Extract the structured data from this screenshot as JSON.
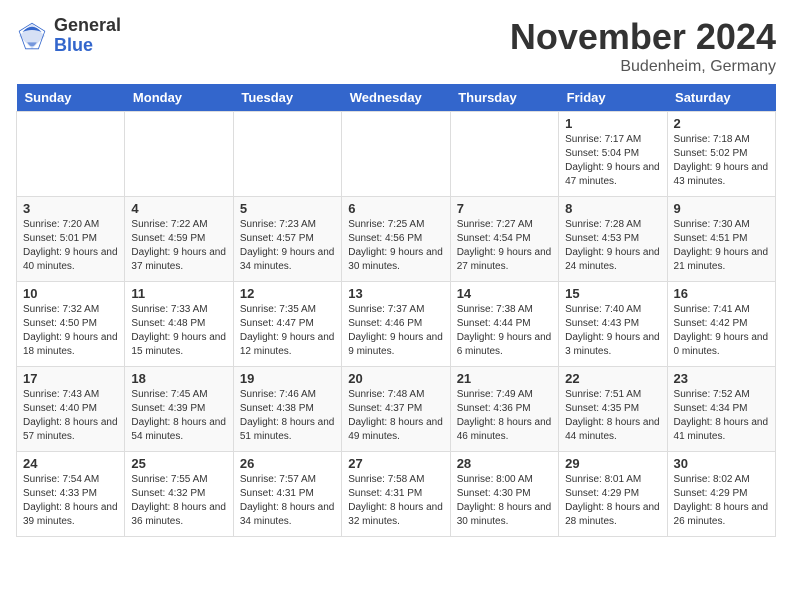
{
  "logo": {
    "general": "General",
    "blue": "Blue"
  },
  "title": "November 2024",
  "location": "Budenheim, Germany",
  "days_header": [
    "Sunday",
    "Monday",
    "Tuesday",
    "Wednesday",
    "Thursday",
    "Friday",
    "Saturday"
  ],
  "weeks": [
    [
      {
        "day": "",
        "info": ""
      },
      {
        "day": "",
        "info": ""
      },
      {
        "day": "",
        "info": ""
      },
      {
        "day": "",
        "info": ""
      },
      {
        "day": "",
        "info": ""
      },
      {
        "day": "1",
        "info": "Sunrise: 7:17 AM\nSunset: 5:04 PM\nDaylight: 9 hours and 47 minutes."
      },
      {
        "day": "2",
        "info": "Sunrise: 7:18 AM\nSunset: 5:02 PM\nDaylight: 9 hours and 43 minutes."
      }
    ],
    [
      {
        "day": "3",
        "info": "Sunrise: 7:20 AM\nSunset: 5:01 PM\nDaylight: 9 hours and 40 minutes."
      },
      {
        "day": "4",
        "info": "Sunrise: 7:22 AM\nSunset: 4:59 PM\nDaylight: 9 hours and 37 minutes."
      },
      {
        "day": "5",
        "info": "Sunrise: 7:23 AM\nSunset: 4:57 PM\nDaylight: 9 hours and 34 minutes."
      },
      {
        "day": "6",
        "info": "Sunrise: 7:25 AM\nSunset: 4:56 PM\nDaylight: 9 hours and 30 minutes."
      },
      {
        "day": "7",
        "info": "Sunrise: 7:27 AM\nSunset: 4:54 PM\nDaylight: 9 hours and 27 minutes."
      },
      {
        "day": "8",
        "info": "Sunrise: 7:28 AM\nSunset: 4:53 PM\nDaylight: 9 hours and 24 minutes."
      },
      {
        "day": "9",
        "info": "Sunrise: 7:30 AM\nSunset: 4:51 PM\nDaylight: 9 hours and 21 minutes."
      }
    ],
    [
      {
        "day": "10",
        "info": "Sunrise: 7:32 AM\nSunset: 4:50 PM\nDaylight: 9 hours and 18 minutes."
      },
      {
        "day": "11",
        "info": "Sunrise: 7:33 AM\nSunset: 4:48 PM\nDaylight: 9 hours and 15 minutes."
      },
      {
        "day": "12",
        "info": "Sunrise: 7:35 AM\nSunset: 4:47 PM\nDaylight: 9 hours and 12 minutes."
      },
      {
        "day": "13",
        "info": "Sunrise: 7:37 AM\nSunset: 4:46 PM\nDaylight: 9 hours and 9 minutes."
      },
      {
        "day": "14",
        "info": "Sunrise: 7:38 AM\nSunset: 4:44 PM\nDaylight: 9 hours and 6 minutes."
      },
      {
        "day": "15",
        "info": "Sunrise: 7:40 AM\nSunset: 4:43 PM\nDaylight: 9 hours and 3 minutes."
      },
      {
        "day": "16",
        "info": "Sunrise: 7:41 AM\nSunset: 4:42 PM\nDaylight: 9 hours and 0 minutes."
      }
    ],
    [
      {
        "day": "17",
        "info": "Sunrise: 7:43 AM\nSunset: 4:40 PM\nDaylight: 8 hours and 57 minutes."
      },
      {
        "day": "18",
        "info": "Sunrise: 7:45 AM\nSunset: 4:39 PM\nDaylight: 8 hours and 54 minutes."
      },
      {
        "day": "19",
        "info": "Sunrise: 7:46 AM\nSunset: 4:38 PM\nDaylight: 8 hours and 51 minutes."
      },
      {
        "day": "20",
        "info": "Sunrise: 7:48 AM\nSunset: 4:37 PM\nDaylight: 8 hours and 49 minutes."
      },
      {
        "day": "21",
        "info": "Sunrise: 7:49 AM\nSunset: 4:36 PM\nDaylight: 8 hours and 46 minutes."
      },
      {
        "day": "22",
        "info": "Sunrise: 7:51 AM\nSunset: 4:35 PM\nDaylight: 8 hours and 44 minutes."
      },
      {
        "day": "23",
        "info": "Sunrise: 7:52 AM\nSunset: 4:34 PM\nDaylight: 8 hours and 41 minutes."
      }
    ],
    [
      {
        "day": "24",
        "info": "Sunrise: 7:54 AM\nSunset: 4:33 PM\nDaylight: 8 hours and 39 minutes."
      },
      {
        "day": "25",
        "info": "Sunrise: 7:55 AM\nSunset: 4:32 PM\nDaylight: 8 hours and 36 minutes."
      },
      {
        "day": "26",
        "info": "Sunrise: 7:57 AM\nSunset: 4:31 PM\nDaylight: 8 hours and 34 minutes."
      },
      {
        "day": "27",
        "info": "Sunrise: 7:58 AM\nSunset: 4:31 PM\nDaylight: 8 hours and 32 minutes."
      },
      {
        "day": "28",
        "info": "Sunrise: 8:00 AM\nSunset: 4:30 PM\nDaylight: 8 hours and 30 minutes."
      },
      {
        "day": "29",
        "info": "Sunrise: 8:01 AM\nSunset: 4:29 PM\nDaylight: 8 hours and 28 minutes."
      },
      {
        "day": "30",
        "info": "Sunrise: 8:02 AM\nSunset: 4:29 PM\nDaylight: 8 hours and 26 minutes."
      }
    ]
  ]
}
